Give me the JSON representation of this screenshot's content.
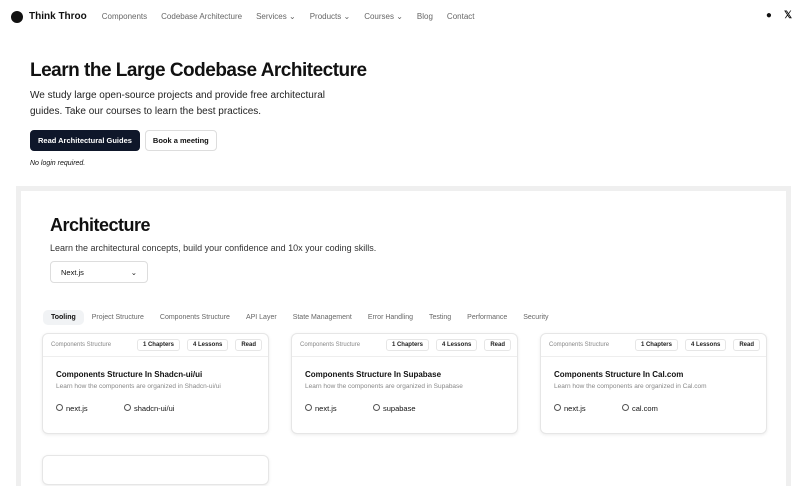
{
  "nav": {
    "brand": "Think Throo",
    "links": [
      "Components",
      "Codebase Architecture",
      "Services ⌄",
      "Products ⌄",
      "Courses ⌄",
      "Blog",
      "Contact"
    ]
  },
  "hero": {
    "title": "Learn the Large Codebase Architecture",
    "description": "We study large open-source projects and provide free architectural guides. Take our courses to learn the best practices.",
    "primary_button": "Read Architectural Guides",
    "secondary_button": "Book a meeting",
    "note": "No login required."
  },
  "architecture": {
    "title": "Architecture",
    "subtitle": "Learn the architectural concepts, build your confidence and 10x your coding skills.",
    "select_value": "Next.js",
    "tabs": [
      "Tooling",
      "Project Structure",
      "Components Structure",
      "API Layer",
      "State Management",
      "Error Handling",
      "Testing",
      "Performance",
      "Security"
    ],
    "cards": [
      {
        "category": "Components Structure",
        "chapters": "1 Chapters",
        "lessons": "4 Lessons",
        "action": "Read",
        "title": "Components Structure In Shadcn-ui/ui",
        "description": "Learn how the components are organized in Shadcn-ui/ui",
        "tags": [
          "next.js",
          "shadcn-ui/ui"
        ]
      },
      {
        "category": "Components Structure",
        "chapters": "1 Chapters",
        "lessons": "4 Lessons",
        "action": "Read",
        "title": "Components Structure In Supabase",
        "description": "Learn how the components are organized in Supabase",
        "tags": [
          "next.js",
          "supabase"
        ]
      },
      {
        "category": "Components Structure",
        "chapters": "1 Chapters",
        "lessons": "4 Lessons",
        "action": "Read",
        "title": "Components Structure In Cal.com",
        "description": "Learn how the components are organized in Cal.com",
        "tags": [
          "next.js",
          "cal.com"
        ]
      }
    ]
  }
}
